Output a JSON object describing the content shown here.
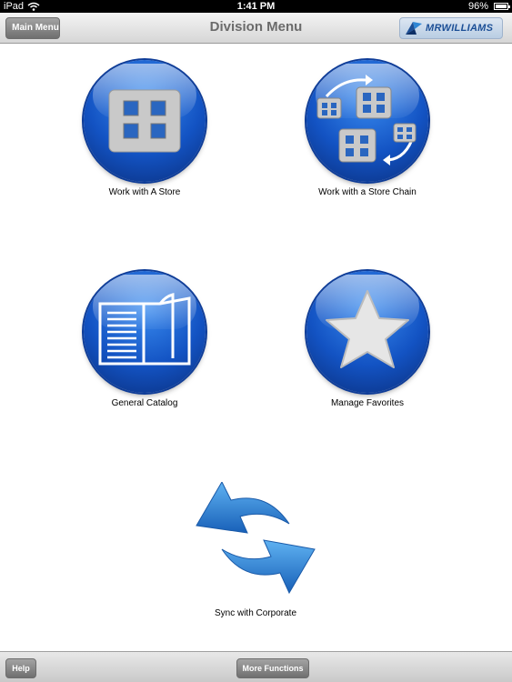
{
  "status_bar": {
    "carrier": "iPad",
    "time": "1:41 PM",
    "battery": "96%"
  },
  "nav_bar": {
    "back_label": "Main Menu",
    "title": "Division Menu",
    "logo_text": "MRWILLIAMS"
  },
  "menu": [
    {
      "label": "Work with A Store",
      "icon": "store-icon"
    },
    {
      "label": "Work with a Store Chain",
      "icon": "store-chain-icon"
    },
    {
      "label": "General Catalog",
      "icon": "catalog-book-icon"
    },
    {
      "label": "Manage Favorites",
      "icon": "star-icon"
    },
    {
      "label": "Sync with Corporate",
      "icon": "sync-arrows-icon"
    }
  ],
  "toolbar": {
    "help_label": "Help",
    "more_label": "More Functions"
  },
  "colors": {
    "accent_blue": "#1353c3",
    "bar_gray": "#6f6f6f"
  }
}
